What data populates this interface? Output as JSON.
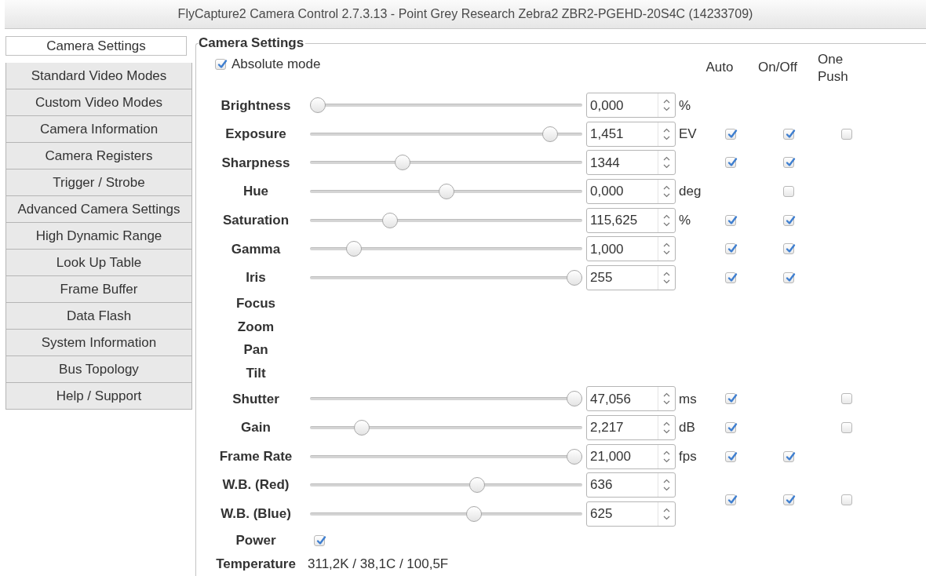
{
  "window": {
    "title": "FlyCapture2 Camera Control 2.7.3.13 - Point Grey Research Zebra2 ZBR2-PGEHD-20S4C (14233709)"
  },
  "sidebar": {
    "items": [
      {
        "label": "Camera Settings",
        "selected": true
      },
      {
        "label": "Standard Video Modes",
        "selected": false
      },
      {
        "label": "Custom Video Modes",
        "selected": false
      },
      {
        "label": "Camera Information",
        "selected": false
      },
      {
        "label": "Camera Registers",
        "selected": false
      },
      {
        "label": "Trigger / Strobe",
        "selected": false
      },
      {
        "label": "Advanced Camera Settings",
        "selected": false
      },
      {
        "label": "High Dynamic Range",
        "selected": false
      },
      {
        "label": "Look Up Table",
        "selected": false
      },
      {
        "label": "Frame Buffer",
        "selected": false
      },
      {
        "label": "Data Flash",
        "selected": false
      },
      {
        "label": "System Information",
        "selected": false
      },
      {
        "label": "Bus Topology",
        "selected": false
      },
      {
        "label": "Help / Support",
        "selected": false
      }
    ]
  },
  "panel": {
    "title": "Camera Settings",
    "absolute_mode": {
      "label": "Absolute mode",
      "checked": true
    },
    "columns": [
      "Auto",
      "On/Off",
      "One Push"
    ],
    "controls": [
      {
        "kind": "slider",
        "label": "Brightness",
        "level": 0,
        "value": "0,000",
        "unit": "%"
      },
      {
        "kind": "slider",
        "label": "Exposure",
        "level": 0.905,
        "value": "1,451",
        "unit": "EV",
        "auto": true,
        "on_off": true,
        "one_push": false
      },
      {
        "kind": "slider",
        "label": "Sharpness",
        "level": 0.33,
        "value": "1344",
        "auto": true,
        "on_off": true
      },
      {
        "kind": "slider",
        "label": "Hue",
        "level": 0.5,
        "value": "0,000",
        "unit": "deg",
        "on_off": false
      },
      {
        "kind": "slider",
        "label": "Saturation",
        "level": 0.28,
        "value": "115,625",
        "unit": "%",
        "auto": true,
        "on_off": true
      },
      {
        "kind": "slider",
        "label": "Gamma",
        "level": 0.14,
        "value": "1,000",
        "auto": true,
        "on_off": true
      },
      {
        "kind": "slider",
        "label": "Iris",
        "level": 1,
        "value": "255",
        "auto": true,
        "on_off": true
      },
      {
        "kind": "label",
        "label": "Focus"
      },
      {
        "kind": "label",
        "label": "Zoom"
      },
      {
        "kind": "label",
        "label": "Pan"
      },
      {
        "kind": "label",
        "label": "Tilt"
      },
      {
        "kind": "slider",
        "label": "Shutter",
        "level": 1,
        "value": "47,056",
        "unit": "ms",
        "auto": true,
        "one_push": false
      },
      {
        "kind": "slider",
        "label": "Gain",
        "level": 0.17,
        "value": "2,217",
        "unit": "dB",
        "auto": true,
        "one_push": false
      },
      {
        "kind": "slider",
        "label": "Frame Rate",
        "level": 1,
        "value": "21,000",
        "unit": "fps",
        "auto": true,
        "on_off": true
      },
      {
        "kind": "slider_pair",
        "sliders": [
          {
            "label": "W.B. (Red)",
            "level": 0.62,
            "value": "636"
          },
          {
            "label": "W.B. (Blue)",
            "level": 0.61,
            "value": "625"
          }
        ],
        "auto": true,
        "on_off": true,
        "one_push": false
      },
      {
        "kind": "checkbox",
        "label": "Power",
        "checked": true
      },
      {
        "kind": "text",
        "label": "Temperature",
        "value": "311,2K / 38,1C / 100,5F"
      }
    ]
  }
}
